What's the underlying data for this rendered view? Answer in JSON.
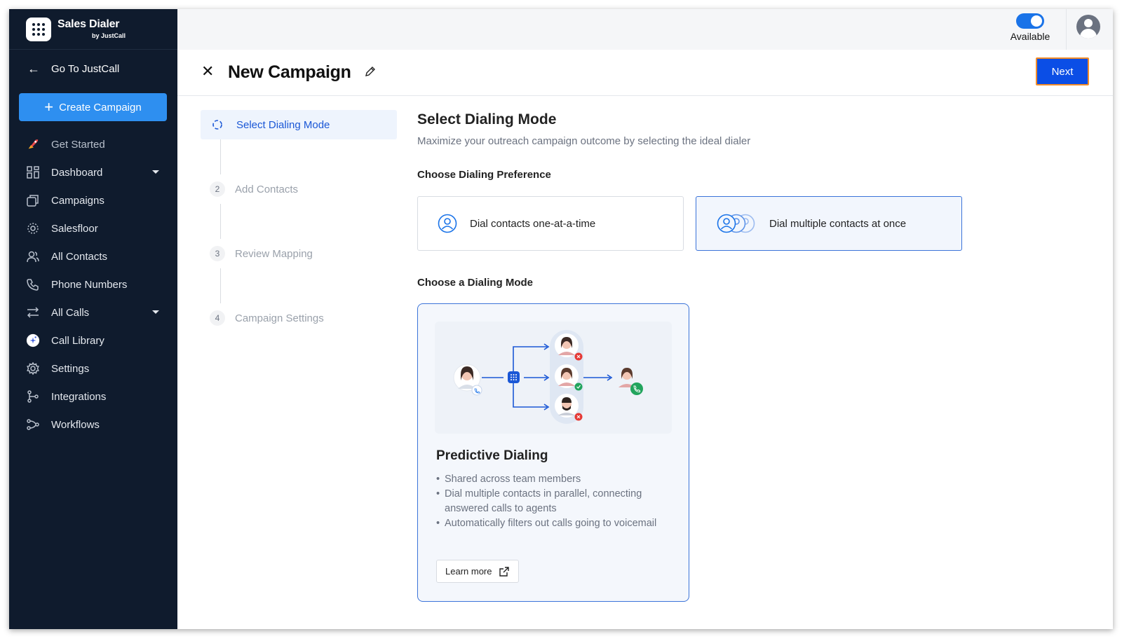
{
  "brand": {
    "title": "Sales Dialer",
    "subtitle": "by JustCall"
  },
  "sidebar": {
    "goto_label": "Go To JustCall",
    "create_label": "Create Campaign",
    "items": [
      {
        "label": "Get Started",
        "icon": "rocket-icon"
      },
      {
        "label": "Dashboard",
        "icon": "dashboard-icon",
        "has_caret": true
      },
      {
        "label": "Campaigns",
        "icon": "campaigns-icon"
      },
      {
        "label": "Salesfloor",
        "icon": "salesfloor-icon"
      },
      {
        "label": "All Contacts",
        "icon": "contacts-icon"
      },
      {
        "label": "Phone Numbers",
        "icon": "phone-icon"
      },
      {
        "label": "All Calls",
        "icon": "calls-icon",
        "has_caret": true
      },
      {
        "label": "Call Library",
        "icon": "call-library-icon"
      },
      {
        "label": "Settings",
        "icon": "gear-icon"
      },
      {
        "label": "Integrations",
        "icon": "integrations-icon"
      },
      {
        "label": "Workflows",
        "icon": "workflows-icon"
      }
    ]
  },
  "topbar": {
    "status_label": "Available",
    "status_on": true
  },
  "header": {
    "title": "New Campaign",
    "next_label": "Next"
  },
  "steps": [
    {
      "number": "",
      "label": "Select Dialing Mode",
      "active": true
    },
    {
      "number": "2",
      "label": "Add Contacts",
      "active": false
    },
    {
      "number": "3",
      "label": "Review Mapping",
      "active": false
    },
    {
      "number": "4",
      "label": "Campaign Settings",
      "active": false
    }
  ],
  "main": {
    "title": "Select Dialing Mode",
    "subtitle": "Maximize your outreach campaign outcome by selecting the ideal dialer",
    "preference_heading": "Choose Dialing Preference",
    "preferences": [
      {
        "label": "Dial contacts one-at-a-time",
        "selected": false
      },
      {
        "label": "Dial multiple contacts at once",
        "selected": true
      }
    ],
    "mode_heading": "Choose a Dialing Mode",
    "mode": {
      "title": "Predictive Dialing",
      "bullets": [
        "Shared across team members",
        "Dial multiple contacts in parallel, connecting answered calls to agents",
        "Automatically filters out calls going to voicemail"
      ],
      "learn_more": "Learn more"
    }
  },
  "colors": {
    "sidebar_bg": "#0f1b2d",
    "accent": "#0b4ee6",
    "create_btn": "#2e8ff0",
    "selected_border": "#3b73d9"
  }
}
